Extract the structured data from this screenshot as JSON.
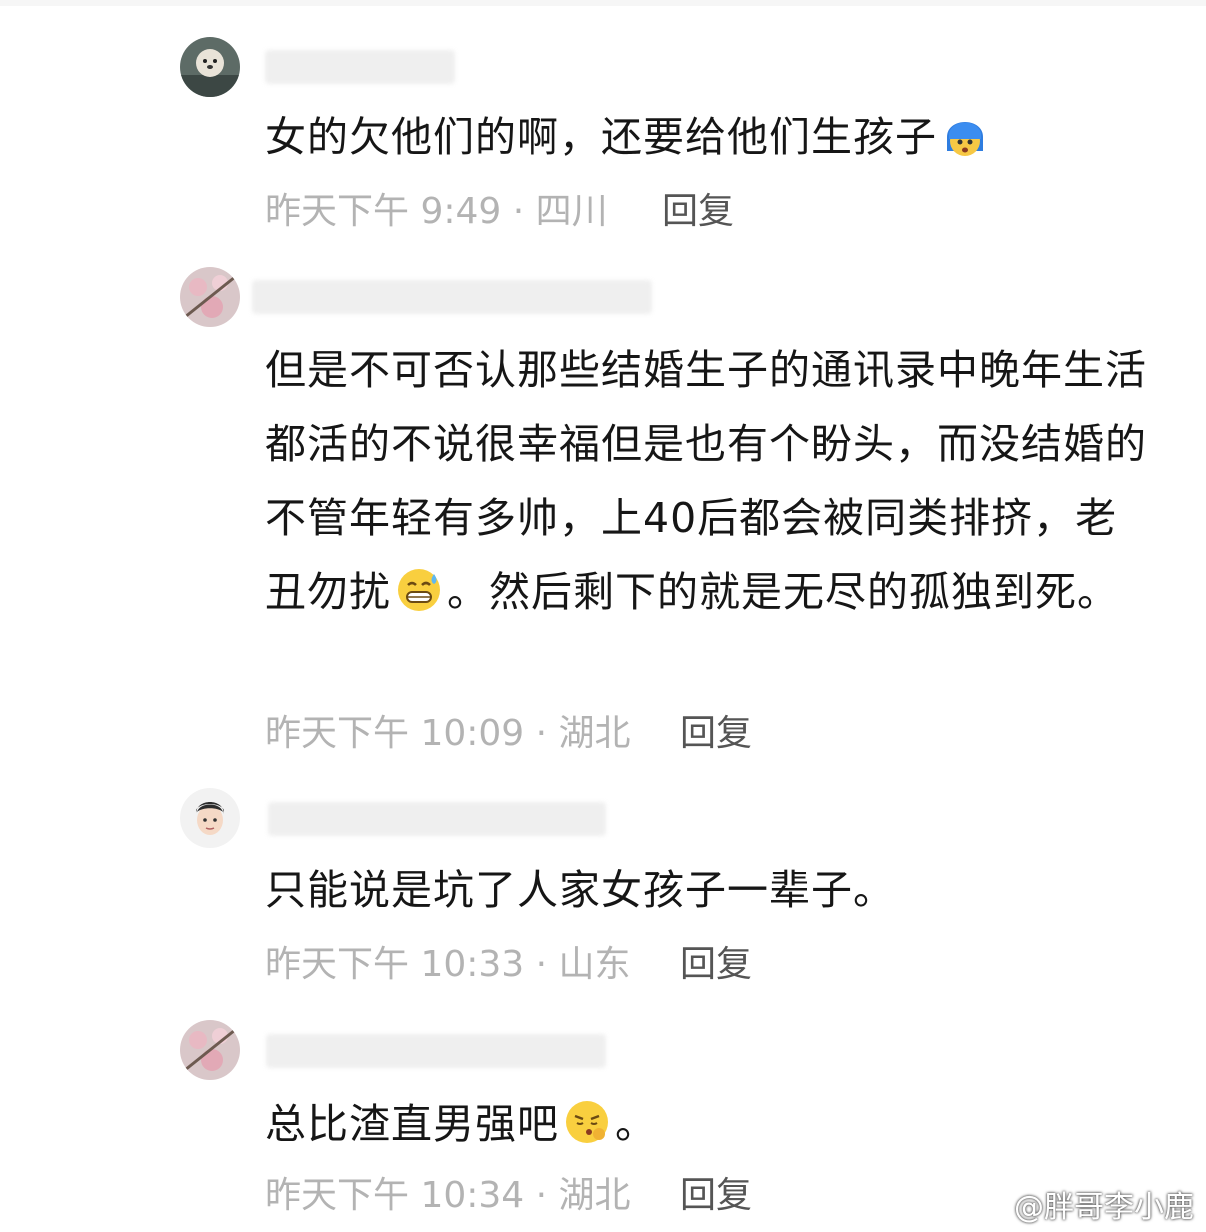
{
  "comments": [
    {
      "text": "女的欠他们的啊，还要给他们生孩子",
      "emoji": "shocked-face-emoji",
      "time": "昨天下午 9:49 · 四川",
      "reply": "回复"
    },
    {
      "text_before": "但是不可否认那些结婚生子的通讯录中晚年生活都活的不说很幸福但是也有个盼头，而没结婚的不管年轻有多帅，上40后都会被同类排挤，老丑勿扰",
      "emoji": "sweat-grin-emoji",
      "text_after": "。然后剩下的就是无尽的孤独到死。",
      "time": "昨天下午 10:09 · 湖北",
      "reply": "回复"
    },
    {
      "text": "只能说是坑了人家女孩子一辈子。",
      "time": "昨天下午 10:33 · 山东",
      "reply": "回复"
    },
    {
      "text": "总比渣直男强吧",
      "emoji": "pouting-face-emoji",
      "text_after": "。",
      "time": "昨天下午 10:34 · 湖北",
      "reply": "回复"
    }
  ],
  "watermark": "@胖哥李小鹿",
  "colors": {
    "text": "#161616",
    "meta": "#b3b3b3",
    "reply": "#555555"
  }
}
